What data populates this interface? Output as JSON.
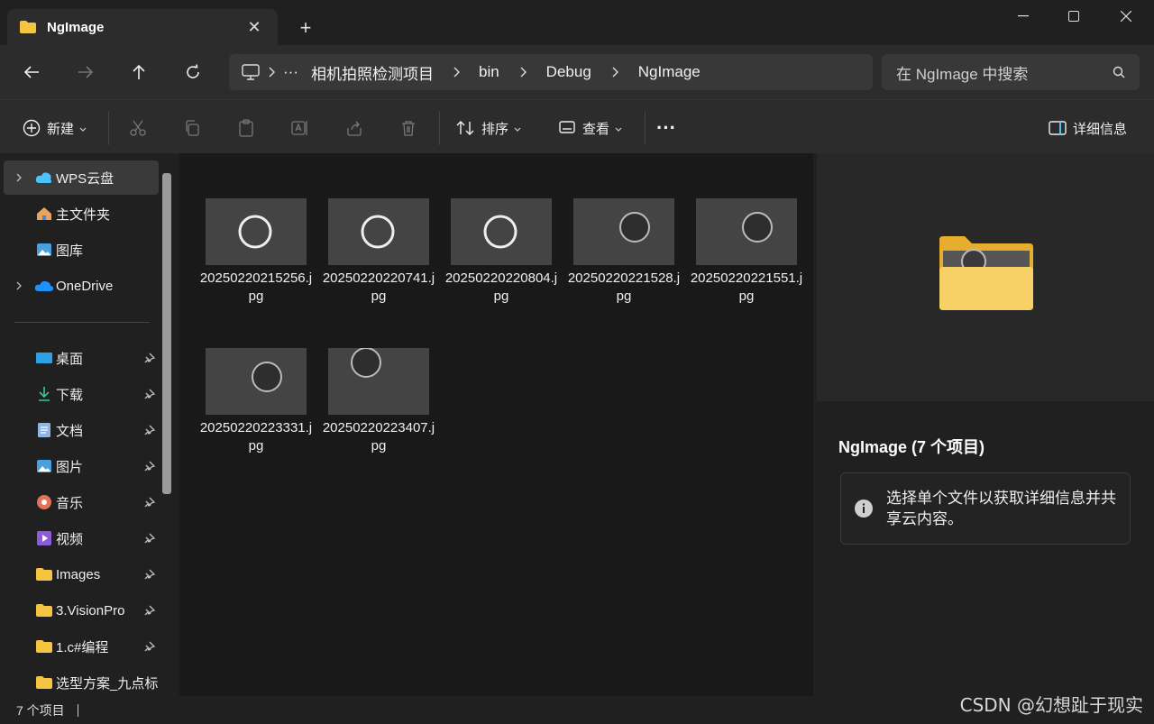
{
  "tab": {
    "title": "NgImage",
    "close_icon": "close-icon",
    "new_tab_label": "+"
  },
  "window_controls": [
    "minimize-icon",
    "maximize-icon",
    "close-icon"
  ],
  "breadcrumb": {
    "more_label": "···",
    "items": [
      "相机拍照检测项目",
      "bin",
      "Debug",
      "NgImage"
    ]
  },
  "search": {
    "placeholder": "在 NgImage 中搜索"
  },
  "commands": {
    "new_label": "新建",
    "sort_label": "排序",
    "view_label": "查看",
    "more_label": "···",
    "details_label": "详细信息"
  },
  "sidebar": {
    "items": [
      {
        "label": "WPS云盘",
        "icon": "cloud-icon"
      },
      {
        "label": "主文件夹",
        "icon": "home-icon"
      },
      {
        "label": "图库",
        "icon": "gallery-icon"
      },
      {
        "label": "OneDrive",
        "icon": "onedrive-icon"
      },
      {
        "label": "桌面",
        "icon": "desktop-icon"
      },
      {
        "label": "下载",
        "icon": "download-icon"
      },
      {
        "label": "文档",
        "icon": "document-icon"
      },
      {
        "label": "图片",
        "icon": "pictures-icon"
      },
      {
        "label": "音乐",
        "icon": "music-icon"
      },
      {
        "label": "视频",
        "icon": "video-icon"
      },
      {
        "label": "Images",
        "icon": "folder-icon"
      },
      {
        "label": "3.VisionPro",
        "icon": "folder-icon"
      },
      {
        "label": "1.c#编程",
        "icon": "folder-icon"
      },
      {
        "label": "选型方案_九点标",
        "icon": "folder-icon"
      }
    ]
  },
  "files": [
    {
      "name": "20250220215256.jpg"
    },
    {
      "name": "20250220220741.jpg"
    },
    {
      "name": "20250220220804.jpg"
    },
    {
      "name": "20250220221528.jpg"
    },
    {
      "name": "20250220221551.jpg"
    },
    {
      "name": "20250220223331.jpg"
    },
    {
      "name": "20250220223407.jpg"
    }
  ],
  "details": {
    "title": "NgImage (7 个项目)",
    "info_text": "选择单个文件以获取详细信息并共享云内容。"
  },
  "status": {
    "count_text": "7 个项目"
  },
  "watermark": "CSDN @幻想趾于现实",
  "colors": {
    "folder": "#f5c542",
    "accent": "#4cc2ff"
  }
}
